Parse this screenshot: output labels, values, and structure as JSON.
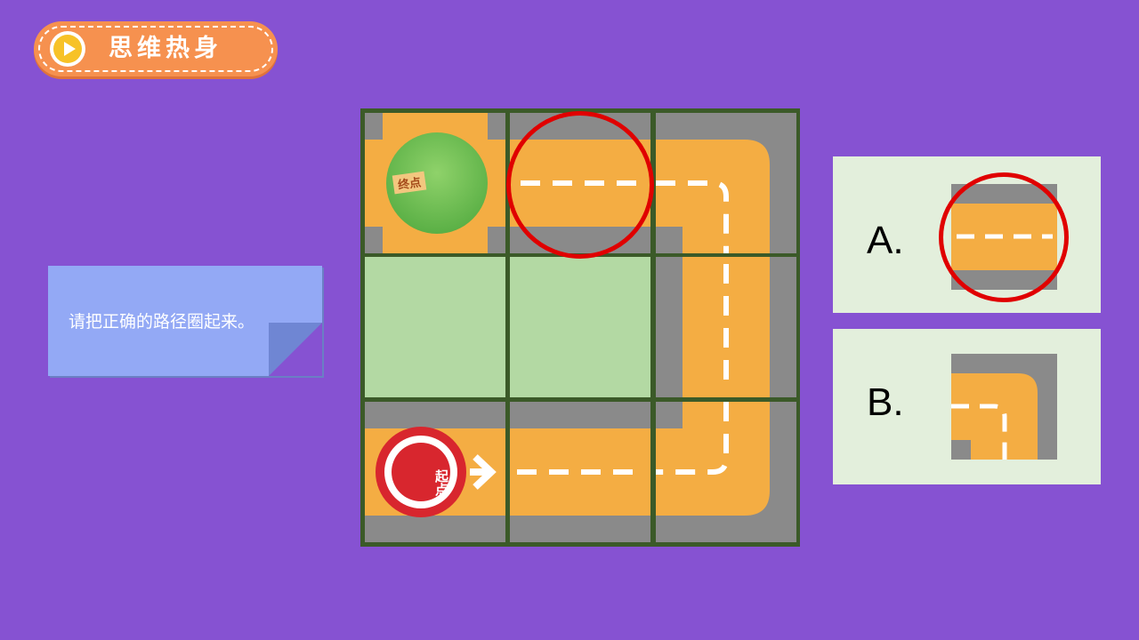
{
  "header": {
    "title": "思维热身",
    "icon": "play-icon"
  },
  "instruction": {
    "text": "请把正确的路径圈起来。"
  },
  "board": {
    "end_label": "终点",
    "start_label": "起点",
    "colors": {
      "road": "#f4ad43",
      "ground": "#8a8a8a",
      "grass": "#b3d9a3",
      "grid": "#3b5a28",
      "highlight": "#e00000"
    }
  },
  "options": [
    {
      "label": "A.",
      "tile": "straight-road-tile",
      "selected": true
    },
    {
      "label": "B.",
      "tile": "curve-road-tile",
      "selected": false
    }
  ]
}
